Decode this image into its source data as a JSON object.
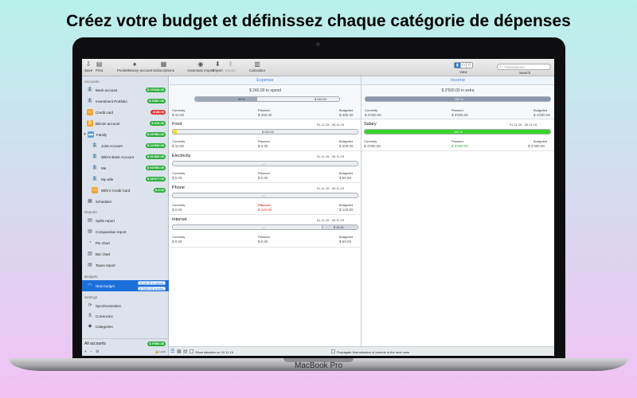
{
  "headline": "Créez votre budget et définissez chaque catégorie de dépenses",
  "brand": "MacBook Pro",
  "toolbar": {
    "save": "Save",
    "print": "Print",
    "pocketmoney": "PocketMoney account",
    "subscriptions": "Subscriptions",
    "auto_import": "Automatic import",
    "import": "Import",
    "export": "Export",
    "calculator": "Calculator",
    "view": "View",
    "search_placeholder": "Transactions",
    "search_label": "Search"
  },
  "sidebar": {
    "accounts_header": "Accounts",
    "accounts": [
      {
        "label": "Bank account",
        "balance": "$ 10'640.00",
        "color": "#2fae3d"
      },
      {
        "label": "Investment Portfolio",
        "balance": "$ 5'897.00",
        "color": "#2fae3d"
      },
      {
        "label": "Credit card",
        "balance": "-$ 85.00",
        "color": "#e23b34"
      },
      {
        "label": "Bitcoin account",
        "balance": "$ 916.36",
        "color": "#2fae3d"
      },
      {
        "label": "Family",
        "balance": "$ 69'960.00",
        "color": "#2fae3d"
      },
      {
        "label": "Joint Account",
        "balance": "$ 24'540.00",
        "color": "#2fae3d"
      },
      {
        "label": "Wife's Bank Account",
        "balance": "$ 51'660.00",
        "color": "#2fae3d"
      },
      {
        "label": "Me",
        "balance": "$ 60'000.00",
        "color": "#2fae3d"
      },
      {
        "label": "My wife",
        "balance": "$ 48'977.00",
        "color": "#2fae3d"
      },
      {
        "label": "Wife's Credit Card",
        "balance": "$ 6.00",
        "color": "#2fae3d"
      }
    ],
    "scheduler": "Scheduler",
    "reports_header": "Reports",
    "reports": [
      "Splits report",
      "Comparative report",
      "Pie chart",
      "Bar chart",
      "Taxes report"
    ],
    "budgets_header": "Budgets",
    "budget": {
      "label": "New budget",
      "to_spend": "$ 240.00 to spend",
      "in_extra": "$ 3'500.00 in extra"
    },
    "settings_header": "Settings",
    "settings": [
      "Synchronization",
      "Currencies",
      "Categories"
    ],
    "all_accounts": "All accounts",
    "all_balance": "$ 9'560.35",
    "lock_label": "Lock"
  },
  "expense": {
    "header": "Expense",
    "summary": "$ 240.00 to spend",
    "bar_pct": 0.43,
    "bar_label": "40 %",
    "bar_amount": "$ 240.00",
    "currently_label": "Currently",
    "planned_label": "Planned",
    "budgeted_label": "Budgeted",
    "currently": "$ 10.00",
    "planned": "$ 250.00",
    "budgeted": "$ 480.00",
    "items": [
      {
        "name": "Food",
        "dates": "01.11.19 - 30.11.19",
        "fill": 0.02,
        "bar_text": "$ 200.00",
        "currently": "$ 10.00",
        "planned": "$ 0.00",
        "budgeted": "$ 200.00",
        "planned_red": false
      },
      {
        "name": "Electricity",
        "dates": "01.11.19 - 30.11.19",
        "fill": 0,
        "bar_text": "---",
        "currently": "$ 0.00",
        "planned": "$ 0.00",
        "budgeted": "$ 50.00",
        "planned_red": false
      },
      {
        "name": "Phone",
        "dates": "01.11.19 - 30.11.19",
        "fill": 0,
        "bar_text": "---",
        "currently": "$ 0.00",
        "planned": "$ 110.00",
        "budgeted": "$ 120.00",
        "planned_red": true
      },
      {
        "name": "Internet",
        "dates": "01.11.19 - 30.11.19",
        "fill": 0,
        "bar_text": "---",
        "bar_amount": "$ 10.00",
        "currently": "$ 0.00",
        "planned": "$ 0.00",
        "budgeted": "$ 50.00",
        "planned_red": false
      }
    ]
  },
  "income": {
    "header": "Income",
    "summary": "$ 3'500.00 in extra",
    "bar_pct": 1.0,
    "bar_label": "100 %",
    "currently": "$ 4'000.00",
    "planned": "$ 3'500.00",
    "budgeted": "$ 4'000.00",
    "items": [
      {
        "name": "Salary",
        "dates": "01.11.19 - 30.11.19",
        "fill": 1.0,
        "bar_text": "100 %",
        "currently": "$ 4'000.00",
        "planned": "$ 3'500.00",
        "budgeted": "$ 4'000.00"
      }
    ]
  },
  "status": {
    "show_situation": "Show situation on 10.11.19",
    "propagate": "Propagate final situation of periods to the next ones"
  },
  "colors": {
    "accent": "#1c6fd8",
    "green": "#2fae3d",
    "red": "#e23b34",
    "lime": "#39d52a",
    "expense_fill": "#f2e31a"
  }
}
